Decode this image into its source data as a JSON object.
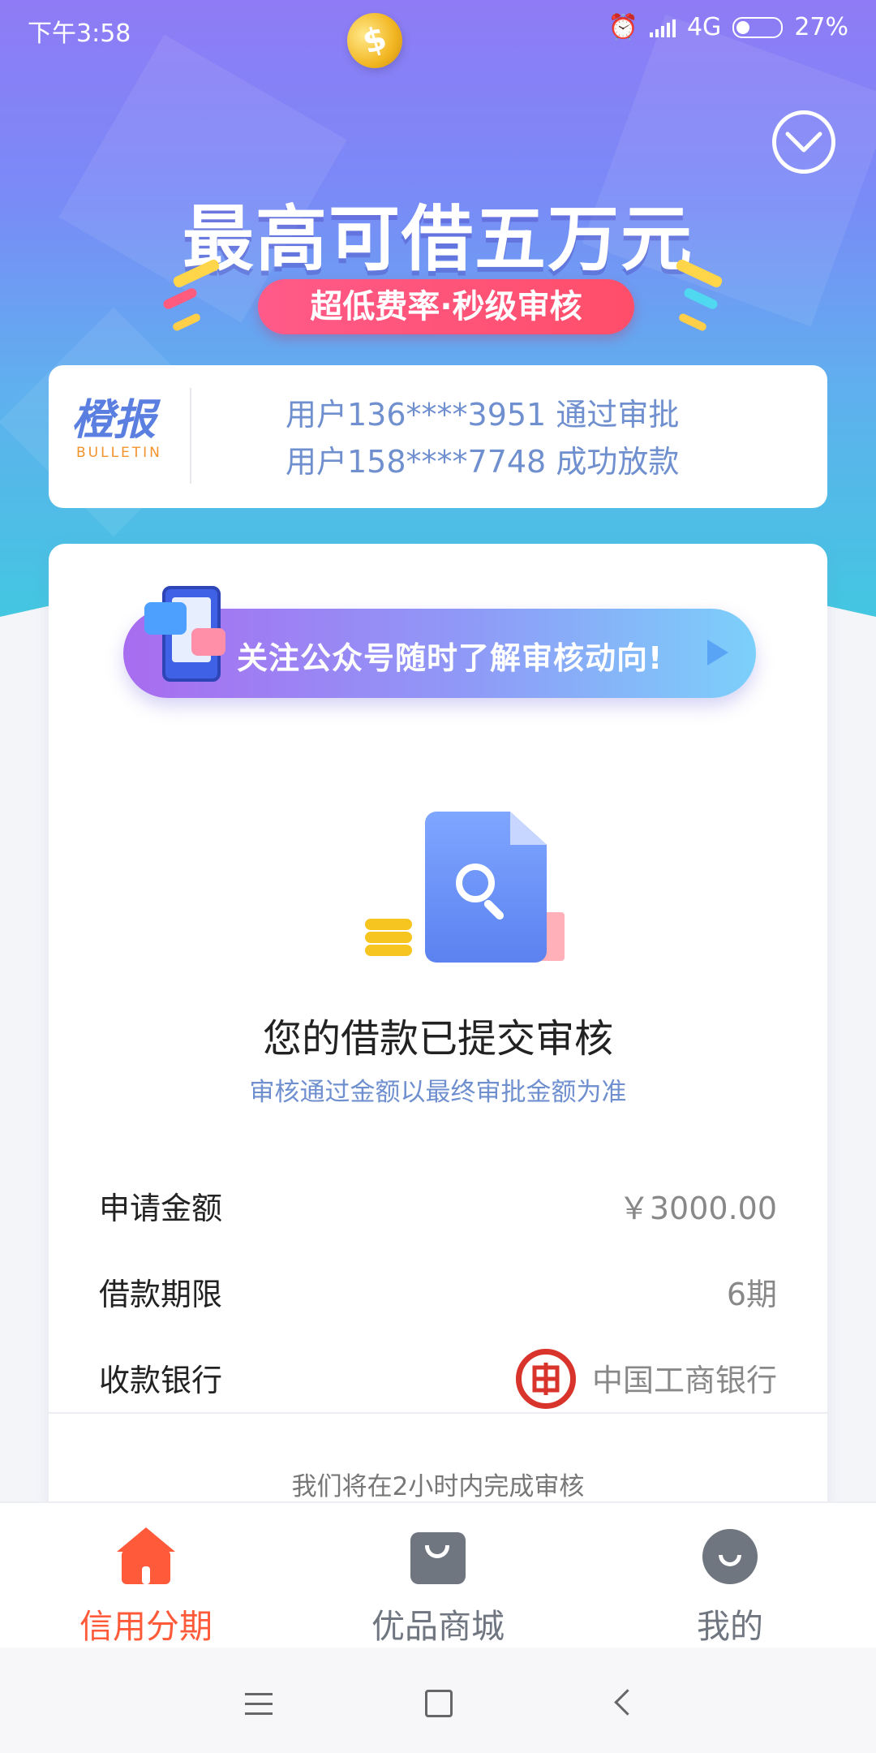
{
  "status_bar": {
    "time": "下午3:58",
    "network": "4G",
    "battery": "27%"
  },
  "hero": {
    "title": "最高可借五万元",
    "tagline": "超低费率·秒级审核",
    "coin_symbol": "$"
  },
  "bulletin": {
    "logo_cn": "橙报",
    "logo_en": "BULLETIN",
    "lines": [
      "用户136****3951 通过审批",
      "用户158****7748 成功放款"
    ]
  },
  "follow_banner": {
    "text": "关注公众号随时了解审核动向!"
  },
  "review": {
    "title": "您的借款已提交审核",
    "subtitle": "审核通过金额以最终审批金额为准",
    "rows": [
      {
        "label": "申请金额",
        "value": "￥3000.00"
      },
      {
        "label": "借款期限",
        "value": "6期"
      },
      {
        "label": "收款银行",
        "value": "中国工商银行"
      }
    ],
    "eta": "我们将在2小时内完成审核"
  },
  "tabs": [
    {
      "label": "信用分期",
      "icon": "home-icon",
      "active": true
    },
    {
      "label": "优品商城",
      "icon": "shopping-bag-icon",
      "active": false
    },
    {
      "label": "我的",
      "icon": "user-icon",
      "active": false
    }
  ],
  "colors": {
    "accent": "#ff5b3a",
    "inactive": "#707680",
    "link_blue": "#6f8fcf"
  }
}
